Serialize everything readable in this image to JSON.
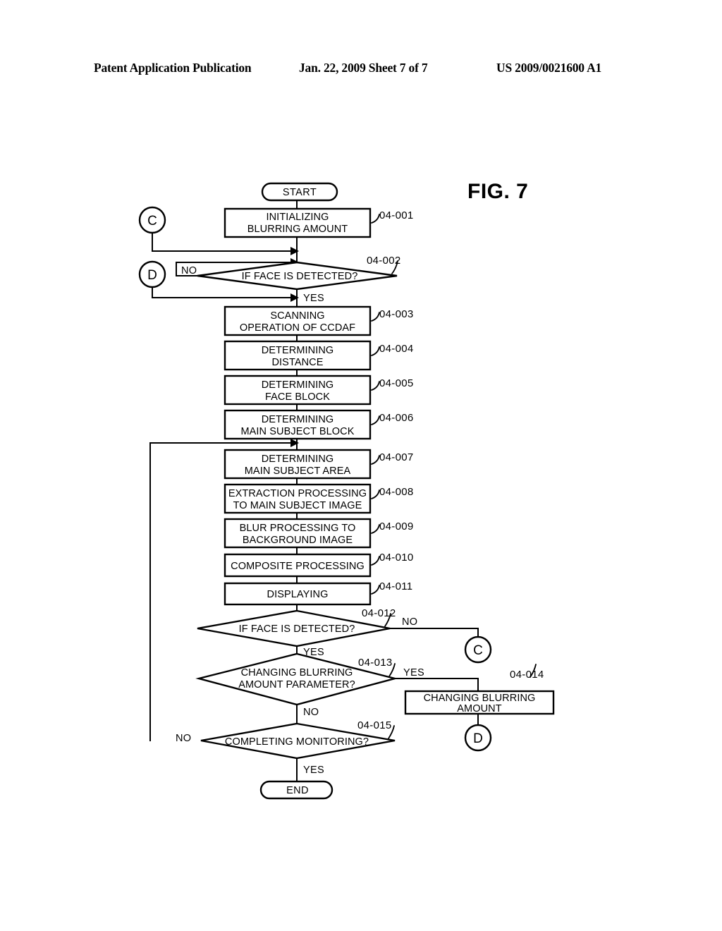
{
  "header": {
    "publication": "Patent Application Publication",
    "date_sheet": "Jan. 22, 2009  Sheet 7 of 7",
    "patent_number": "US 2009/0021600 A1"
  },
  "figure": {
    "label": "FIG. 7"
  },
  "flowchart": {
    "terminals": [
      {
        "id": "start",
        "label": "START"
      },
      {
        "id": "end",
        "label": "END"
      }
    ],
    "connectors": [
      {
        "id": "conn-c-top",
        "label": "C"
      },
      {
        "id": "conn-d-top",
        "label": "D"
      },
      {
        "id": "conn-c-bottom",
        "label": "C"
      },
      {
        "id": "conn-d-bottom",
        "label": "D"
      }
    ],
    "steps": [
      {
        "ref": "04-001",
        "line1": "INITIALIZING",
        "line2": "BLURRING AMOUNT"
      },
      {
        "ref": "04-003",
        "line1": "SCANNING",
        "line2": "OPERATION OF CCDAF"
      },
      {
        "ref": "04-004",
        "line1": "DETERMINING",
        "line2": "DISTANCE"
      },
      {
        "ref": "04-005",
        "line1": "DETERMINING",
        "line2": "FACE BLOCK"
      },
      {
        "ref": "04-006",
        "line1": "DETERMINING",
        "line2": "MAIN SUBJECT BLOCK"
      },
      {
        "ref": "04-007",
        "line1": "DETERMINING",
        "line2": "MAIN SUBJECT AREA"
      },
      {
        "ref": "04-008",
        "line1": "EXTRACTION PROCESSING",
        "line2": "TO MAIN SUBJECT IMAGE"
      },
      {
        "ref": "04-009",
        "line1": "BLUR PROCESSING TO",
        "line2": "BACKGROUND IMAGE"
      },
      {
        "ref": "04-010",
        "line1": "COMPOSITE PROCESSING",
        "line2": ""
      },
      {
        "ref": "04-011",
        "line1": "DISPLAYING",
        "line2": ""
      },
      {
        "ref": "04-014",
        "line1": "CHANGING BLURRING",
        "line2": "AMOUNT"
      }
    ],
    "decisions": [
      {
        "ref": "04-002",
        "line1": "IF FACE IS DETECTED?",
        "line2": "",
        "yes": "YES",
        "no": "NO"
      },
      {
        "ref": "04-012",
        "line1": "IF FACE IS DETECTED?",
        "line2": "",
        "yes": "YES",
        "no": "NO"
      },
      {
        "ref": "04-013",
        "line1": "CHANGING BLURRING",
        "line2": "AMOUNT PARAMETER?",
        "yes": "YES",
        "no": "NO"
      },
      {
        "ref": "04-015",
        "line1": "COMPLETING MONITORING?",
        "line2": "",
        "yes": "YES",
        "no": "NO"
      }
    ]
  },
  "colors": {
    "ink": "#000000",
    "paper": "#ffffff"
  }
}
